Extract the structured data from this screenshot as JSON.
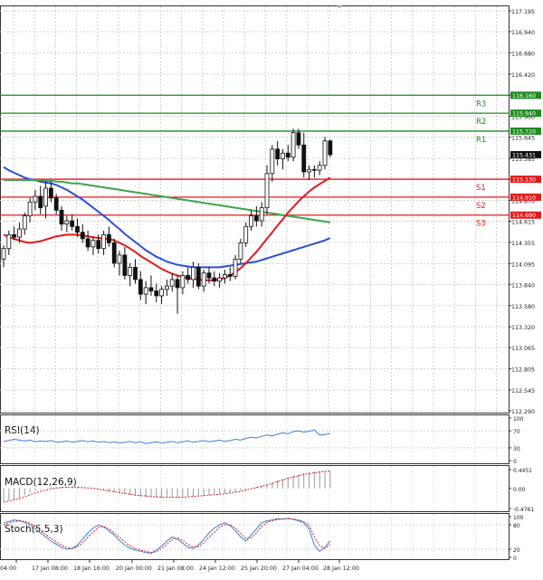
{
  "chart_data": [
    {
      "type": "candlestick",
      "ylim": [
        112.29,
        117.195
      ],
      "y_ticks": [
        "117.195",
        "116.940",
        "116.680",
        "116.420",
        "116.160",
        "115.900",
        "115.645",
        "115.385",
        "115.130",
        "114.870",
        "114.615",
        "114.355",
        "114.095",
        "113.840",
        "113.580",
        "113.320",
        "113.065",
        "112.805",
        "112.545",
        "112.290"
      ],
      "x_ticks": [
        "04:00",
        "17 Jan 08:00",
        "18 Jan 16:00",
        "20 Jan 00:00",
        "21 Jan 08:00",
        "24 Jan 12:00",
        "25 Jan 20:00",
        "27 Jan 04:00",
        "28 Jan 12:00"
      ],
      "grid": true,
      "current_price": {
        "label": "115.431",
        "value": 115.431
      },
      "levels": [
        {
          "name": "R3",
          "value": 116.16,
          "price_label": "116.160",
          "color": "#1f8b1f"
        },
        {
          "name": "R2",
          "value": 115.94,
          "price_label": "115.940",
          "color": "#1f8b1f"
        },
        {
          "name": "R1",
          "value": 115.72,
          "price_label": "115.720",
          "color": "#1f8b1f"
        },
        {
          "name": "S1",
          "value": 115.13,
          "price_label": "115.130",
          "color": "#e01b1b"
        },
        {
          "name": "S2",
          "value": 114.91,
          "price_label": "114.910",
          "color": "#e01b1b"
        },
        {
          "name": "S3",
          "value": 114.69,
          "price_label": "114.690",
          "color": "#e01b1b"
        }
      ],
      "candles": [
        [
          114.15,
          114.32,
          114.05,
          114.28
        ],
        [
          114.28,
          114.5,
          114.2,
          114.45
        ],
        [
          114.45,
          114.55,
          114.38,
          114.42
        ],
        [
          114.42,
          114.6,
          114.35,
          114.52
        ],
        [
          114.52,
          114.72,
          114.45,
          114.68
        ],
        [
          114.68,
          114.9,
          114.6,
          114.85
        ],
        [
          114.85,
          115.0,
          114.75,
          114.92
        ],
        [
          114.92,
          115.05,
          114.7,
          114.78
        ],
        [
          114.8,
          115.1,
          114.65,
          115.02
        ],
        [
          115.02,
          115.1,
          114.85,
          114.9
        ],
        [
          114.9,
          114.95,
          114.7,
          114.75
        ],
        [
          114.75,
          114.8,
          114.5,
          114.58
        ],
        [
          114.58,
          114.68,
          114.48,
          114.62
        ],
        [
          114.62,
          114.7,
          114.5,
          114.55
        ],
        [
          114.55,
          114.65,
          114.42,
          114.48
        ],
        [
          114.48,
          114.58,
          114.35,
          114.4
        ],
        [
          114.4,
          114.5,
          114.25,
          114.3
        ],
        [
          114.3,
          114.42,
          114.2,
          114.38
        ],
        [
          114.38,
          114.45,
          114.22,
          114.28
        ],
        [
          114.28,
          114.5,
          114.2,
          114.45
        ],
        [
          114.45,
          114.55,
          114.3,
          114.35
        ],
        [
          114.35,
          114.4,
          114.05,
          114.1
        ],
        [
          114.1,
          114.25,
          113.95,
          114.2
        ],
        [
          114.2,
          114.3,
          113.9,
          113.95
        ],
        [
          113.95,
          114.1,
          113.82,
          114.05
        ],
        [
          114.05,
          114.15,
          113.85,
          113.9
        ],
        [
          113.9,
          114.0,
          113.65,
          113.72
        ],
        [
          113.72,
          113.88,
          113.6,
          113.8
        ],
        [
          113.8,
          113.95,
          113.7,
          113.76
        ],
        [
          113.76,
          113.85,
          113.62,
          113.7
        ],
        [
          113.7,
          113.82,
          113.6,
          113.78
        ],
        [
          113.78,
          113.9,
          113.7,
          113.82
        ],
        [
          113.82,
          113.98,
          113.75,
          113.9
        ],
        [
          113.9,
          113.95,
          113.48,
          113.8
        ],
        [
          113.8,
          114.0,
          113.72,
          113.95
        ],
        [
          113.95,
          114.05,
          113.85,
          113.9
        ],
        [
          113.9,
          114.12,
          113.8,
          114.05
        ],
        [
          114.05,
          114.1,
          113.78,
          113.82
        ],
        [
          113.82,
          114.02,
          113.75,
          113.98
        ],
        [
          113.98,
          114.05,
          113.85,
          113.92
        ],
        [
          113.92,
          114.0,
          113.82,
          113.88
        ],
        [
          113.88,
          113.98,
          113.8,
          113.92
        ],
        [
          113.92,
          114.02,
          113.85,
          113.96
        ],
        [
          113.96,
          114.05,
          113.88,
          113.94
        ],
        [
          113.94,
          114.2,
          113.9,
          114.15
        ],
        [
          114.15,
          114.4,
          114.1,
          114.35
        ],
        [
          114.35,
          114.6,
          114.3,
          114.55
        ],
        [
          114.55,
          114.75,
          114.5,
          114.68
        ],
        [
          114.68,
          114.8,
          114.55,
          114.62
        ],
        [
          114.62,
          114.85,
          114.55,
          114.78
        ],
        [
          114.78,
          115.3,
          114.7,
          115.2
        ],
        [
          115.2,
          115.55,
          115.1,
          115.5
        ],
        [
          115.5,
          115.6,
          115.3,
          115.38
        ],
        [
          115.38,
          115.5,
          115.25,
          115.45
        ],
        [
          115.45,
          115.55,
          115.35,
          115.4
        ],
        [
          115.4,
          115.75,
          115.35,
          115.7
        ],
        [
          115.7,
          115.75,
          115.5,
          115.55
        ],
        [
          115.55,
          115.7,
          115.15,
          115.22
        ],
        [
          115.22,
          115.3,
          115.12,
          115.25
        ],
        [
          115.25,
          115.3,
          115.15,
          115.24
        ],
        [
          115.24,
          115.35,
          115.18,
          115.3
        ],
        [
          115.3,
          115.65,
          115.25,
          115.6
        ],
        [
          115.6,
          115.62,
          115.4,
          115.431
        ]
      ],
      "series": [
        {
          "color": "#2a4fd6",
          "values": [
            115.28,
            115.24,
            115.21,
            115.18,
            115.15,
            115.13,
            115.12,
            115.1,
            115.09,
            115.08,
            115.06,
            115.03,
            115.0,
            114.96,
            114.92,
            114.88,
            114.83,
            114.78,
            114.73,
            114.68,
            114.63,
            114.57,
            114.52,
            114.46,
            114.41,
            114.36,
            114.31,
            114.26,
            114.22,
            114.18,
            114.15,
            114.12,
            114.1,
            114.08,
            114.07,
            114.06,
            114.05,
            114.05,
            114.05,
            114.05,
            114.05,
            114.05,
            114.06,
            114.07,
            114.08,
            114.09,
            114.1,
            114.11,
            114.12,
            114.14,
            114.16,
            114.18,
            114.2,
            114.22,
            114.24,
            114.26,
            114.28,
            114.3,
            114.32,
            114.34,
            114.36,
            114.38,
            114.41
          ]
        },
        {
          "color": "#3fa34d",
          "values": [
            115.12,
            115.12,
            115.12,
            115.12,
            115.12,
            115.12,
            115.12,
            115.12,
            115.11,
            115.11,
            115.1,
            115.1,
            115.09,
            115.08,
            115.08,
            115.07,
            115.06,
            115.05,
            115.04,
            115.03,
            115.02,
            115.01,
            115.0,
            114.99,
            114.98,
            114.97,
            114.96,
            114.95,
            114.94,
            114.93,
            114.92,
            114.91,
            114.9,
            114.89,
            114.88,
            114.87,
            114.86,
            114.85,
            114.84,
            114.83,
            114.82,
            114.81,
            114.8,
            114.79,
            114.78,
            114.77,
            114.76,
            114.75,
            114.74,
            114.73,
            114.72,
            114.71,
            114.7,
            114.69,
            114.68,
            114.67,
            114.66,
            114.65,
            114.64,
            114.63,
            114.62,
            114.61,
            114.6
          ]
        },
        {
          "color": "#e01b1b",
          "values": [
            114.45,
            114.42,
            114.4,
            114.38,
            114.36,
            114.35,
            114.36,
            114.37,
            114.39,
            114.41,
            114.43,
            114.44,
            114.45,
            114.45,
            114.45,
            114.44,
            114.43,
            114.42,
            114.41,
            114.4,
            114.4,
            114.38,
            114.35,
            114.32,
            114.28,
            114.24,
            114.19,
            114.15,
            114.11,
            114.07,
            114.03,
            114.0,
            113.97,
            113.95,
            113.93,
            113.92,
            113.91,
            113.9,
            113.89,
            113.89,
            113.89,
            113.9,
            113.92,
            113.95,
            113.99,
            114.04,
            114.1,
            114.17,
            114.24,
            114.32,
            114.4,
            114.48,
            114.56,
            114.64,
            114.72,
            114.79,
            114.86,
            114.92,
            114.98,
            115.03,
            115.07,
            115.11,
            115.15
          ]
        }
      ]
    },
    {
      "type": "line",
      "title": "RSI(14)",
      "ylim": [
        0,
        100
      ],
      "y_ticks": [
        "100",
        "70",
        "30",
        "0"
      ],
      "series": [
        {
          "color": "#3a7fd8",
          "values": [
            45,
            47,
            50,
            48,
            46,
            48,
            44,
            46,
            45,
            47,
            43,
            44,
            46,
            43,
            45,
            47,
            44,
            46,
            43,
            45,
            42,
            44,
            41,
            43,
            45,
            42,
            44,
            40,
            42,
            44,
            41,
            43,
            45,
            42,
            44,
            46,
            43,
            45,
            47,
            44,
            46,
            48,
            45,
            47,
            50,
            48,
            52,
            55,
            53,
            57,
            60,
            58,
            62,
            65,
            63,
            68,
            70,
            67,
            69,
            72,
            60,
            61,
            64
          ]
        }
      ]
    },
    {
      "type": "bar",
      "title": "MACD(12,26,9)",
      "ylim": [
        -0.4761,
        0.4451
      ],
      "y_ticks": [
        "0.4451",
        "0.00",
        "-0.4761"
      ],
      "values": [
        -0.3,
        -0.28,
        -0.26,
        -0.22,
        -0.16,
        -0.1,
        -0.06,
        -0.02,
        0.0,
        0.02,
        0.03,
        0.04,
        0.04,
        0.04,
        0.03,
        0.02,
        0.01,
        -0.01,
        -0.03,
        -0.05,
        -0.07,
        -0.09,
        -0.11,
        -0.13,
        -0.15,
        -0.17,
        -0.19,
        -0.2,
        -0.21,
        -0.22,
        -0.22,
        -0.22,
        -0.22,
        -0.22,
        -0.21,
        -0.2,
        -0.19,
        -0.18,
        -0.17,
        -0.16,
        -0.15,
        -0.14,
        -0.12,
        -0.1,
        -0.08,
        -0.05,
        -0.02,
        0.01,
        0.04,
        0.07,
        0.11,
        0.15,
        0.19,
        0.23,
        0.27,
        0.3,
        0.33,
        0.36,
        0.38,
        0.4,
        0.41,
        0.42,
        0.43
      ],
      "signal": [
        -0.32,
        -0.3,
        -0.27,
        -0.24,
        -0.2,
        -0.15,
        -0.11,
        -0.07,
        -0.04,
        -0.01,
        0.01,
        0.02,
        0.03,
        0.03,
        0.03,
        0.02,
        0.01,
        0.0,
        -0.02,
        -0.04,
        -0.06,
        -0.08,
        -0.1,
        -0.12,
        -0.14,
        -0.16,
        -0.17,
        -0.18,
        -0.19,
        -0.2,
        -0.21,
        -0.21,
        -0.21,
        -0.21,
        -0.21,
        -0.2,
        -0.19,
        -0.18,
        -0.17,
        -0.16,
        -0.15,
        -0.14,
        -0.13,
        -0.11,
        -0.09,
        -0.07,
        -0.04,
        -0.01,
        0.02,
        0.05,
        0.08,
        0.12,
        0.16,
        0.2,
        0.24,
        0.27,
        0.3,
        0.33,
        0.35,
        0.37,
        0.39,
        0.4,
        0.41
      ]
    },
    {
      "type": "line",
      "title": "Stoch(5,5,3)",
      "ylim": [
        0,
        100
      ],
      "y_ticks": [
        "100",
        "80",
        "20",
        "0"
      ],
      "series": [
        {
          "color": "#3a7fd8",
          "values": [
            85,
            88,
            92,
            90,
            86,
            80,
            70,
            60,
            50,
            40,
            32,
            25,
            20,
            22,
            30,
            45,
            60,
            72,
            80,
            75,
            65,
            55,
            42,
            30,
            22,
            18,
            15,
            12,
            10,
            18,
            28,
            40,
            50,
            45,
            35,
            25,
            22,
            30,
            45,
            60,
            72,
            80,
            85,
            78,
            65,
            50,
            40,
            55,
            70,
            85,
            90,
            92,
            95,
            94,
            96,
            93,
            90,
            85,
            70,
            30,
            15,
            25,
            40
          ]
        },
        {
          "color": "#e01b1b",
          "values": [
            80,
            84,
            88,
            90,
            88,
            84,
            76,
            66,
            56,
            46,
            38,
            30,
            24,
            22,
            26,
            36,
            50,
            62,
            74,
            76,
            70,
            60,
            50,
            38,
            28,
            22,
            18,
            15,
            12,
            14,
            22,
            32,
            44,
            48,
            42,
            32,
            26,
            26,
            36,
            50,
            62,
            74,
            80,
            80,
            72,
            58,
            46,
            48,
            60,
            76,
            86,
            90,
            93,
            94,
            95,
            94,
            92,
            88,
            78,
            50,
            28,
            22,
            32
          ]
        }
      ]
    }
  ]
}
